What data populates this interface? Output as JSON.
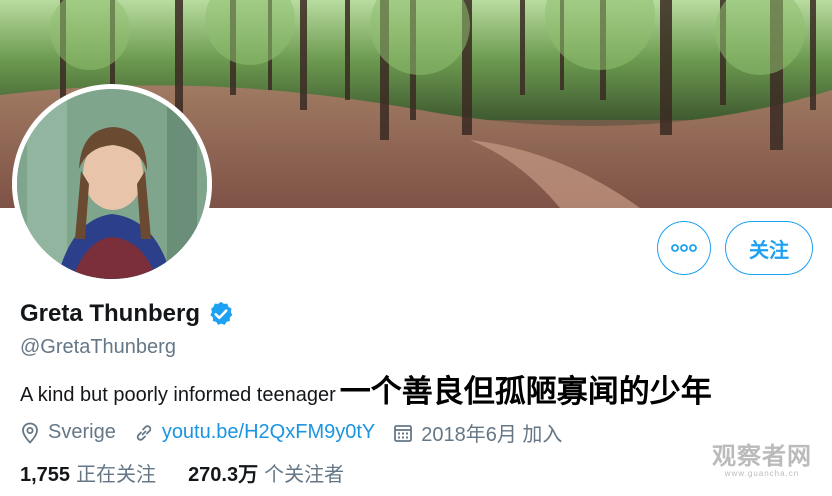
{
  "profile": {
    "display_name": "Greta Thunberg",
    "handle": "@GretaThunberg",
    "bio_en": "A kind but poorly informed teenager",
    "bio_cn": "一个善良但孤陋寡闻的少年",
    "location": "Sverige",
    "website": "youtu.be/H2QxFM9y0tY",
    "joined": "2018年6月 加入",
    "verified": true
  },
  "actions": {
    "more_label": "···",
    "follow_label": "关注"
  },
  "stats": {
    "following_count": "1,755",
    "following_label": "正在关注",
    "followers_count": "270.3万",
    "followers_label": "个关注者"
  },
  "watermark": {
    "main": "观察者网",
    "sub": "www.guancha.cn"
  },
  "colors": {
    "accent": "#1da1f2",
    "link": "#1b95e0",
    "muted": "#657786",
    "text": "#14171a"
  },
  "icons": [
    "verified-badge-icon",
    "location-pin-icon",
    "link-icon",
    "calendar-icon",
    "more-dots-icon"
  ]
}
